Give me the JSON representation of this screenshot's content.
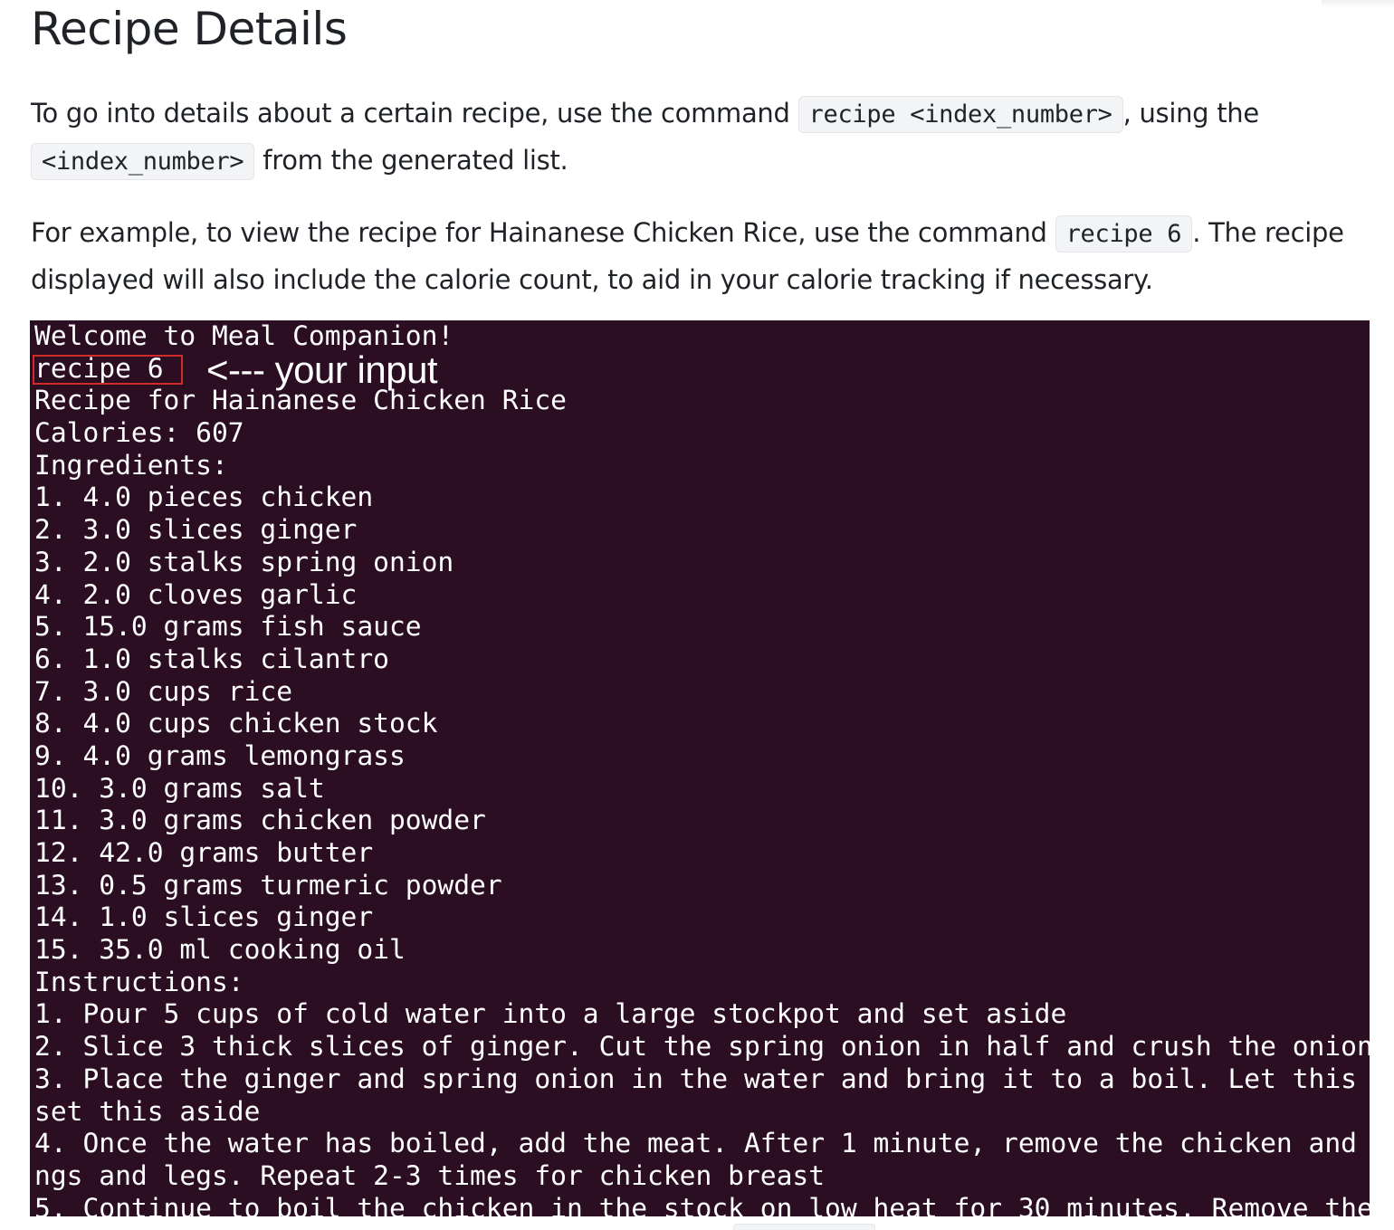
{
  "doc": {
    "title": "Recipe Details",
    "para1": {
      "text1": "To go into details about a certain recipe, use the command ",
      "code1": "recipe <index_number>",
      "text2": ", using the ",
      "code2": "<index_number>",
      "text3": " from the generated list."
    },
    "para2": {
      "text1": "For example, to view the recipe for Hainanese Chicken Rice, use the command ",
      "code1": "recipe 6",
      "text2": ". The recipe displayed will also include the calorie count, to aid in your calorie tracking if necessary."
    }
  },
  "terminal": {
    "background": "#2c0e22",
    "highlight_color": "#d12a2a",
    "annotation": "<--- your input",
    "lines": [
      "Welcome to Meal Companion!",
      "recipe 6",
      "Recipe for Hainanese Chicken Rice",
      "Calories: 607",
      "Ingredients:",
      "1. 4.0 pieces chicken",
      "2. 3.0 slices ginger",
      "3. 2.0 stalks spring onion",
      "4. 2.0 cloves garlic",
      "5. 15.0 grams fish sauce",
      "6. 1.0 stalks cilantro",
      "7. 3.0 cups rice",
      "8. 4.0 cups chicken stock",
      "9. 4.0 grams lemongrass",
      "10. 3.0 grams salt",
      "11. 3.0 grams chicken powder",
      "12. 42.0 grams butter",
      "13. 0.5 grams turmeric powder",
      "14. 1.0 slices ginger",
      "15. 35.0 ml cooking oil",
      "Instructions:",
      "1. Pour 5 cups of cold water into a large stockpot and set aside",
      "2. Slice 3 thick slices of ginger. Cut the spring onion in half and crush the onion",
      "3. Place the ginger and spring onion in the water and bring it to a boil. Let this",
      "set this aside",
      "4. Once the water has boiled, add the meat. After 1 minute, remove the chicken and",
      "ngs and legs. Repeat 2-3 times for chicken breast",
      "5. Continue to boil the chicken in the stock on low heat for 30 minutes. Remove the"
    ]
  }
}
